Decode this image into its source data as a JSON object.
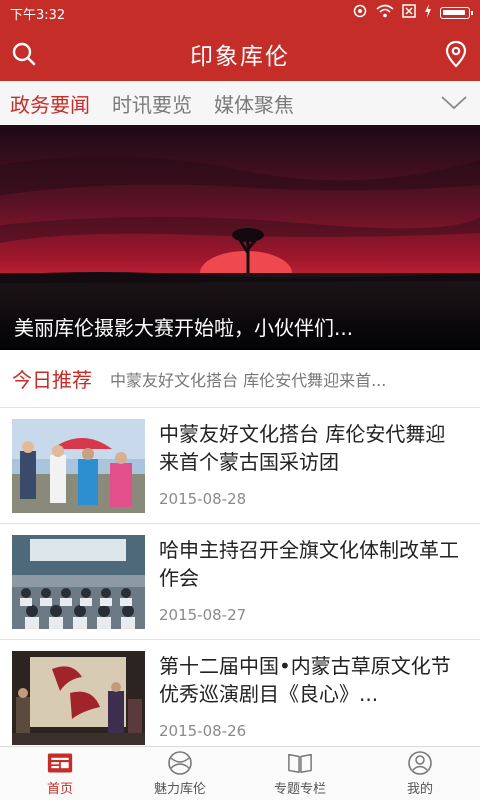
{
  "status_bar": {
    "time": "下午3:32"
  },
  "header": {
    "title": "印象库伦"
  },
  "tabs": [
    {
      "label": "政务要闻",
      "active": true
    },
    {
      "label": "时讯要览",
      "active": false
    },
    {
      "label": "媒体聚焦",
      "active": false
    }
  ],
  "banner": {
    "caption": "美丽库伦摄影大赛开始啦，小伙伴们..."
  },
  "recommend": {
    "title": "今日推荐",
    "ticker": "中蒙友好文化搭台 库伦安代舞迎来首..."
  },
  "news": [
    {
      "title": "中蒙友好文化搭台 库伦安代舞迎来首个蒙古国采访团",
      "date": "2015-08-28"
    },
    {
      "title": "哈申主持召开全旗文化体制改革工作会",
      "date": "2015-08-27"
    },
    {
      "title": "第十二届中国•内蒙古草原文化节优秀巡演剧目《良心》...",
      "date": "2015-08-26"
    }
  ],
  "bottom_nav": [
    {
      "label": "首页",
      "icon": "home-icon",
      "active": true
    },
    {
      "label": "魅力库伦",
      "icon": "globe-icon",
      "active": false
    },
    {
      "label": "专题专栏",
      "icon": "book-icon",
      "active": false
    },
    {
      "label": "我的",
      "icon": "user-icon",
      "active": false
    }
  ],
  "colors": {
    "brand": "#c52d28",
    "tab_inactive": "#7a7a7a",
    "text": "#222222",
    "muted": "#8a8a8a"
  }
}
